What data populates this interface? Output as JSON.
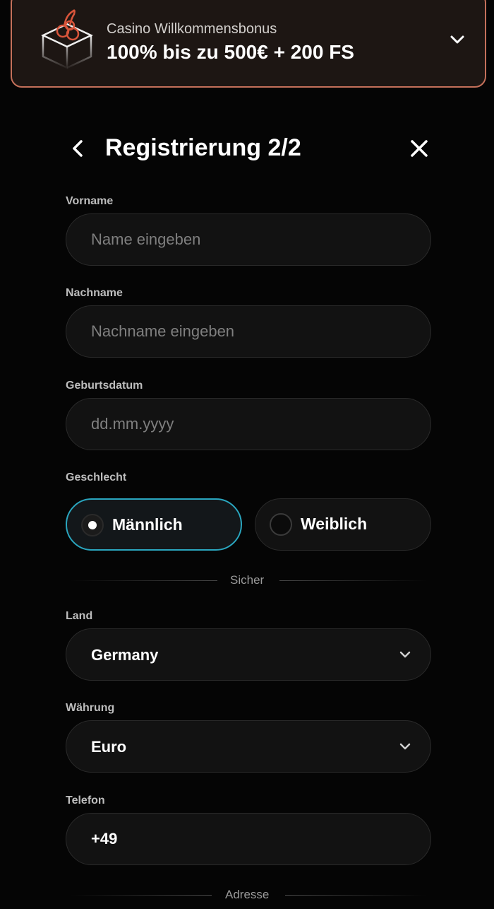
{
  "bonus": {
    "subtitle": "Casino Willkommensbonus",
    "title": "100% bis zu 500€ + 200 FS"
  },
  "header": {
    "title": "Registrierung 2/2"
  },
  "form": {
    "first_name": {
      "label": "Vorname",
      "placeholder": "Name eingeben",
      "value": ""
    },
    "last_name": {
      "label": "Nachname",
      "placeholder": "Nachname eingeben",
      "value": ""
    },
    "birthdate": {
      "label": "Geburtsdatum",
      "placeholder": "dd.mm.yyyy",
      "value": ""
    },
    "gender": {
      "label": "Geschlecht",
      "options": [
        "Männlich",
        "Weiblich"
      ],
      "selected": "Männlich"
    },
    "divider_secure": "Sicher",
    "country": {
      "label": "Land",
      "value": "Germany"
    },
    "currency": {
      "label": "Währung",
      "value": "Euro"
    },
    "phone": {
      "label": "Telefon",
      "value": "+49"
    },
    "divider_address": "Adresse"
  },
  "colors": {
    "background": "#050505",
    "accent_border": "#c4705a",
    "selected_border": "#2aa6bf",
    "input_bg": "#121212"
  },
  "icons": {
    "bonus": "gift-box-icon",
    "banner_toggle": "chevron-down-icon",
    "back": "chevron-left-icon",
    "close": "close-icon",
    "select": "chevron-down-icon"
  }
}
